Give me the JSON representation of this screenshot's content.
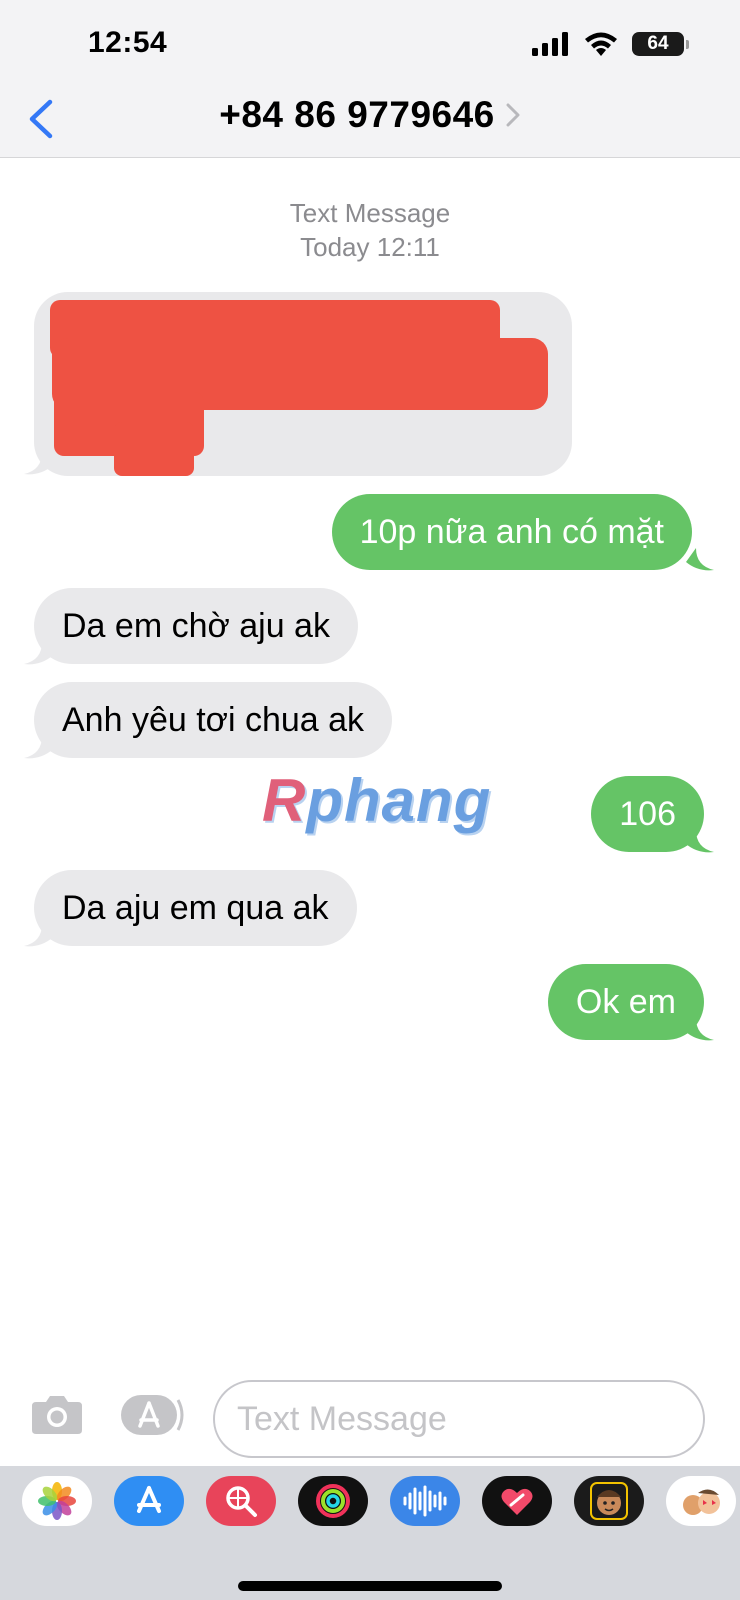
{
  "status_bar": {
    "time": "12:54",
    "battery": "64"
  },
  "header": {
    "contact": "+84 86 9779646"
  },
  "conversation": {
    "service": "Text Message",
    "timestamp": "Today 12:11",
    "messages": [
      {
        "direction": "incoming",
        "text": "",
        "redacted": true
      },
      {
        "direction": "outgoing",
        "text": "10p nữa anh có mặt"
      },
      {
        "direction": "incoming",
        "text": "Da em chờ aju ak"
      },
      {
        "direction": "incoming",
        "text": "Anh yêu tơi chua ak"
      },
      {
        "direction": "outgoing",
        "text": "106"
      },
      {
        "direction": "incoming",
        "text": "Da aju em qua ak"
      },
      {
        "direction": "outgoing",
        "text": "Ok em"
      }
    ]
  },
  "watermark": {
    "first": "R",
    "rest": "phang"
  },
  "composer": {
    "placeholder": "Text Message",
    "value": ""
  },
  "app_drawer": [
    "photos-icon",
    "app-store-icon",
    "web-search-icon",
    "activity-icon",
    "audio-message-icon",
    "digital-touch-icon",
    "memoji-icon",
    "memoji-stickers-icon"
  ],
  "colors": {
    "outgoing_bubble": "#65c466",
    "incoming_bubble": "#e9e9eb",
    "accent": "#3478f6"
  }
}
